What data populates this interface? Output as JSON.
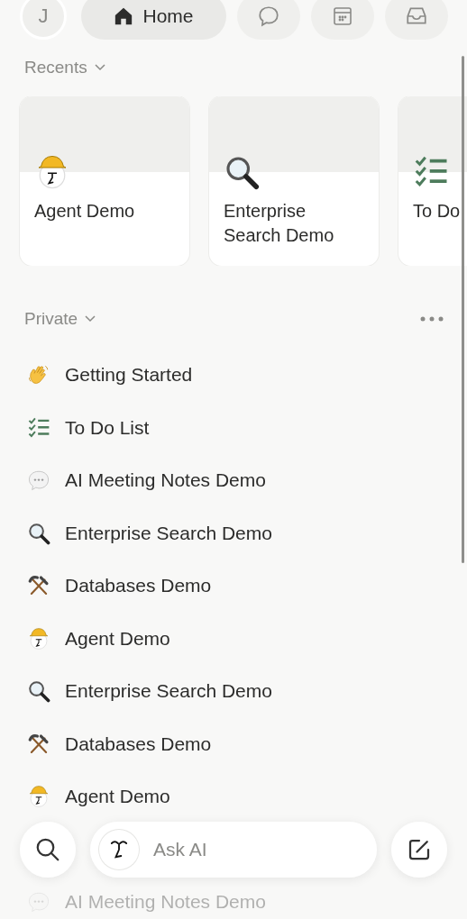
{
  "top_bar": {
    "avatar": "J",
    "tabs": [
      {
        "kind": "home",
        "label": "Home",
        "selected": true
      },
      {
        "kind": "chat",
        "selected": false
      },
      {
        "kind": "calendar",
        "selected": false
      },
      {
        "kind": "inbox",
        "selected": false
      }
    ]
  },
  "recents": {
    "title": "Recents",
    "cards": [
      {
        "kind": "agent",
        "title": "Agent Demo"
      },
      {
        "kind": "search",
        "title": "Enterprise Search Demo"
      },
      {
        "kind": "todo",
        "title": "To Do"
      }
    ]
  },
  "private": {
    "title": "Private",
    "items": [
      {
        "kind": "wave",
        "title": "Getting Started",
        "faded": false
      },
      {
        "kind": "todo",
        "title": "To Do List",
        "faded": false
      },
      {
        "kind": "chat",
        "title": "AI Meeting Notes Demo",
        "faded": false
      },
      {
        "kind": "search",
        "title": "Enterprise Search Demo",
        "faded": false
      },
      {
        "kind": "tools",
        "title": "Databases Demo",
        "faded": false
      },
      {
        "kind": "agent",
        "title": "Agent Demo",
        "faded": false
      },
      {
        "kind": "search",
        "title": "Enterprise Search Demo",
        "faded": false
      },
      {
        "kind": "tools",
        "title": "Databases Demo",
        "faded": false
      },
      {
        "kind": "agent",
        "title": "Agent Demo",
        "faded": false
      },
      {
        "kind": "chat",
        "title": "AI Meeting Notes Demo",
        "faded": true
      }
    ]
  },
  "bottom_bar": {
    "ask_placeholder": "Ask AI"
  }
}
